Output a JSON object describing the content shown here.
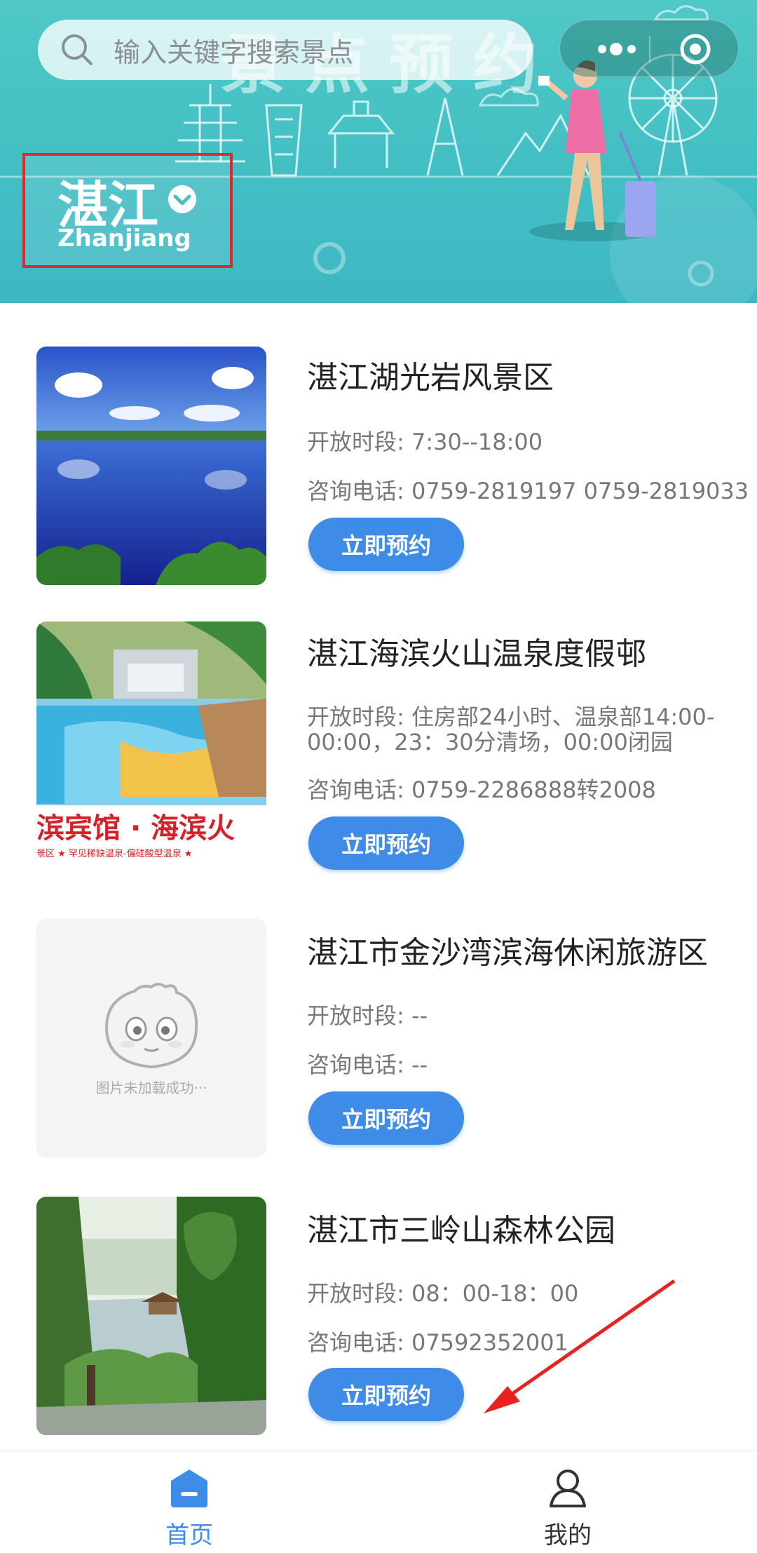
{
  "header": {
    "banner_title": "景点预约",
    "search_placeholder": "输入关键字搜索景点",
    "city_name": "湛江",
    "city_pinyin": "Zhanjiang"
  },
  "spots": [
    {
      "name": "湛江湖光岩风景区",
      "hours": "开放时段: 7:30--18:00",
      "phone": "咨询电话: 0759-2819197 0759-2819033",
      "button": "立即预约"
    },
    {
      "name": "湛江海滨火山温泉度假邨",
      "hours": "开放时段: 住房部24小时、温泉部14:00-00:00，23：30分清场，00:00闭园",
      "phone": "咨询电话: 0759-2286888转2008",
      "button": "立即预约",
      "image_text": "滨宾馆 · 海滨火",
      "image_subtext": "景区  ★ 罕见稀缺温泉-偏硅酸型温泉 ★"
    },
    {
      "name": "湛江市金沙湾滨海休闲旅游区",
      "hours": "开放时段: --",
      "phone": "咨询电话: --",
      "button": "立即预约",
      "image_placeholder": "图片未加载成功···"
    },
    {
      "name": "湛江市三岭山森林公园",
      "hours": "开放时段: 08：00-18：00",
      "phone": "咨询电话: 07592352001",
      "button": "立即预约"
    }
  ],
  "tabbar": {
    "home_label": "首页",
    "mine_label": "我的",
    "active_color": "#3f8be8",
    "inactive_color": "#333333"
  },
  "colors": {
    "accent": "#3f8be8",
    "highlight_box": "#e02a2a",
    "banner": "#4fc8c6"
  }
}
